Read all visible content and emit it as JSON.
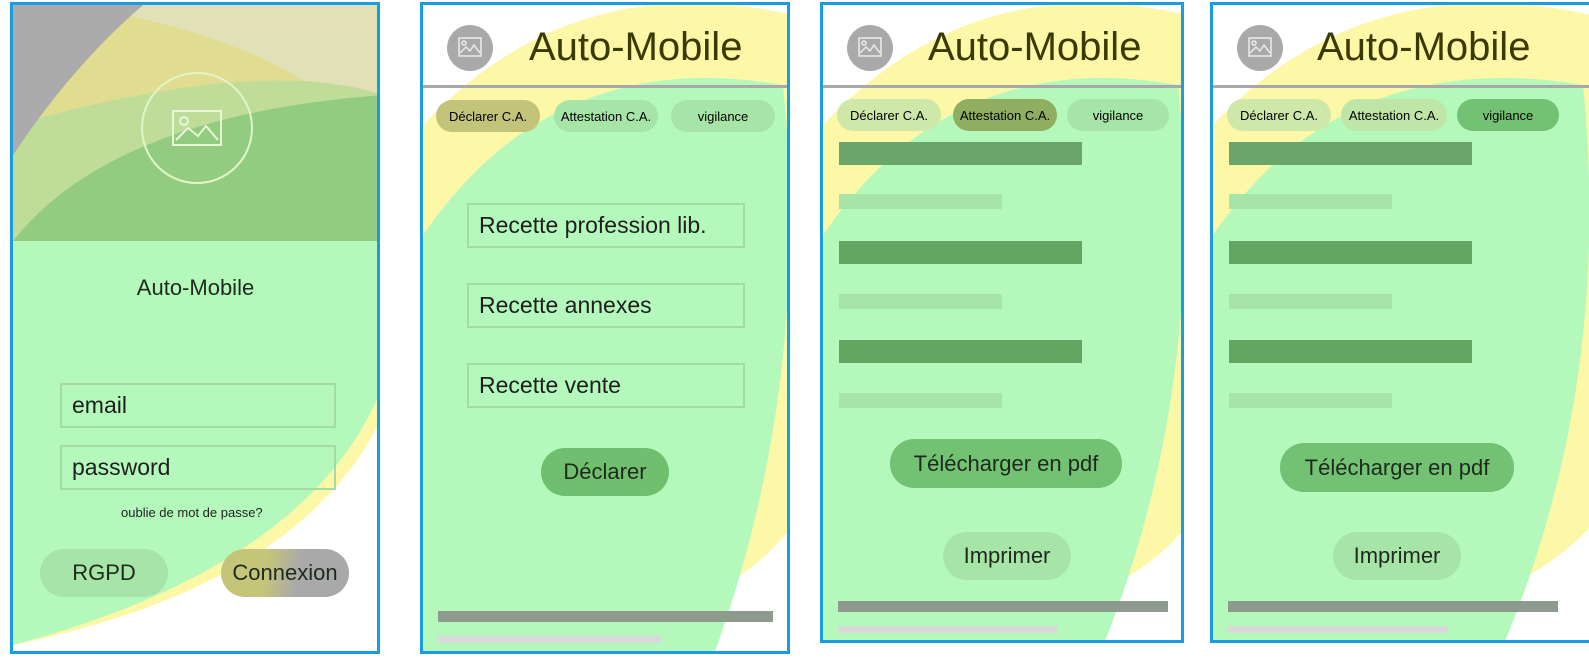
{
  "screens": {
    "login": {
      "app_title": "Auto-Mobile",
      "email_placeholder": "email",
      "password_placeholder": "password",
      "forgot_password": "oublie de mot de passe?",
      "rgpd_button": "RGPD",
      "login_button": "Connexion"
    },
    "declare": {
      "app_title": "Auto-Mobile",
      "tabs": [
        "Déclarer C.A.",
        "Attestation C.A.",
        "vigilance"
      ],
      "active_tab": "Déclarer C.A.",
      "fields": [
        "Recette profession lib.",
        "Recette annexes",
        "Recette vente"
      ],
      "submit_button": "Déclarer"
    },
    "attestation": {
      "app_title": "Auto-Mobile",
      "tabs": [
        "Déclarer C.A.",
        "Attestation C.A.",
        "vigilance"
      ],
      "active_tab": "Attestation C.A.",
      "download_button": "Télécharger en pdf",
      "print_button": "Imprimer"
    },
    "vigilance": {
      "app_title": "Auto-Mobile",
      "tabs": [
        "Déclarer C.A.",
        "Attestation C.A.",
        "vigilance"
      ],
      "active_tab": "vigilance",
      "download_button": "Télécharger en pdf",
      "print_button": "Imprimer"
    }
  },
  "icons": {
    "logo": "image-placeholder-icon"
  },
  "colors": {
    "frame_border": "#1a9ce0",
    "heat_green": "#b4f9bb",
    "heat_yellow": "#fdf7a8",
    "dark_green": "#5fa65f",
    "light_green": "#a7e4a7",
    "gray": "#a9a9a9",
    "olive": "#a8a86a"
  }
}
